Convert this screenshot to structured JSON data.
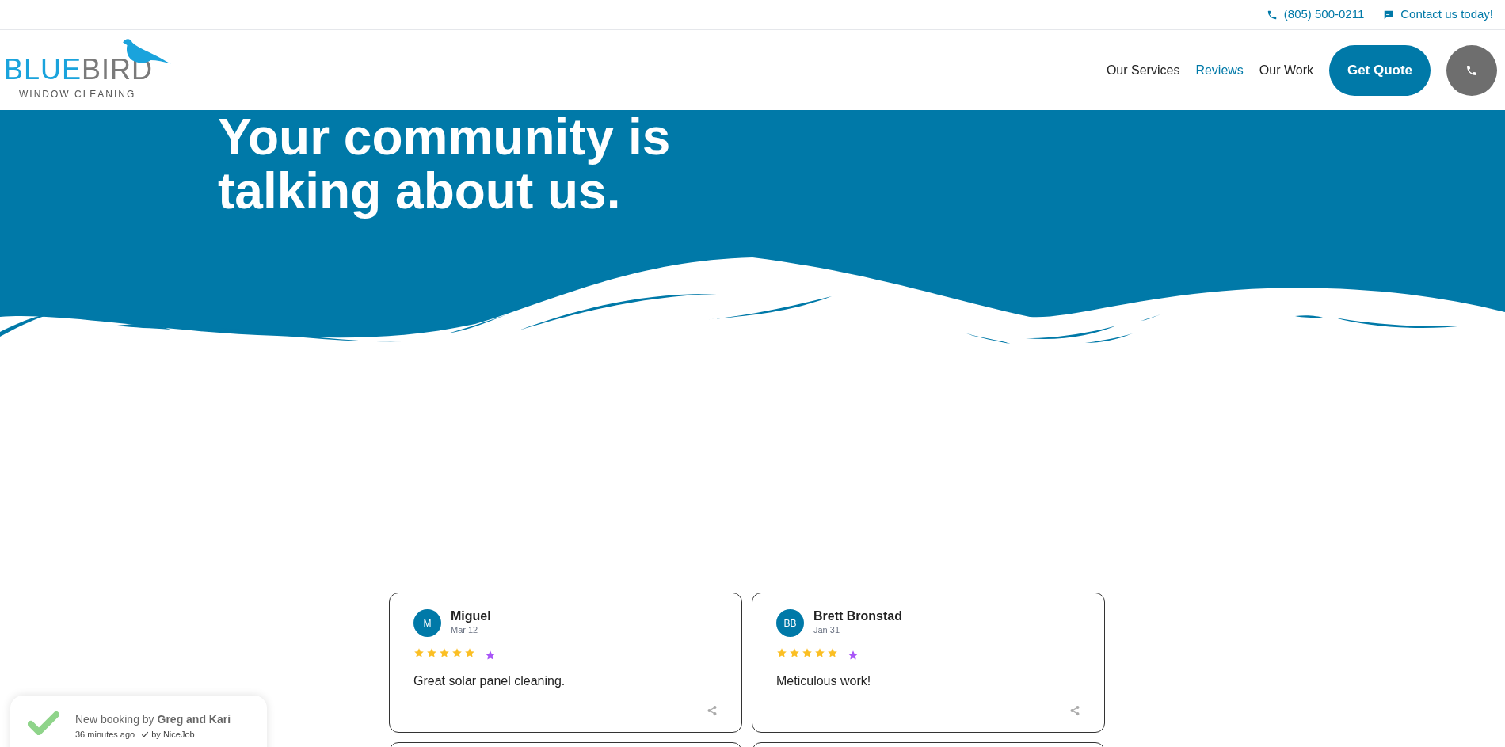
{
  "top_bar": {
    "phone": "(805) 500-0211",
    "contact": "Contact us today!"
  },
  "logo": {
    "brand_first": "BLUE",
    "brand_second": "BIRD",
    "tagline": "WINDOW CLEANING"
  },
  "nav": [
    {
      "label": "Our Services",
      "selected": false
    },
    {
      "label": "Reviews",
      "selected": true
    },
    {
      "label": "Our Work",
      "selected": false
    }
  ],
  "quote_button": "Get Quote",
  "hero": {
    "title": "Your community is talking about us."
  },
  "reviews": [
    {
      "initials": "M",
      "name": "Miguel",
      "date": "Mar 12",
      "stars": 5,
      "text": "Great solar panel cleaning."
    },
    {
      "initials": "BB",
      "name": "Brett Bronstad",
      "date": "Jan 31",
      "stars": 5,
      "text": "Meticulous work!"
    }
  ],
  "toast": {
    "message": "New booking by **Greg and Kari**",
    "time": "36 minutes ago",
    "source": "by NiceJob"
  }
}
